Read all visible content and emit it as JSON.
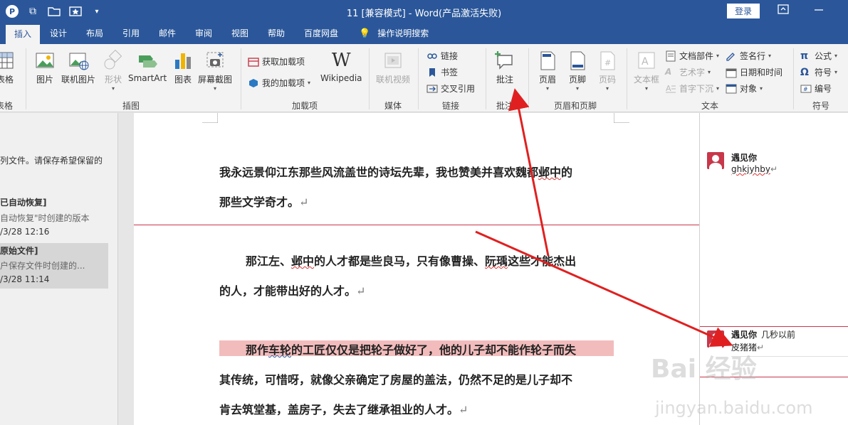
{
  "titlebar": {
    "title": "11 [兼容模式]  -  Word(产品激活失败)",
    "login": "登录",
    "qat_icons": [
      "powerpoint-icon",
      "window-switch-icon",
      "open-folder-icon",
      "favorite-icon",
      "customize-qat-icon"
    ]
  },
  "tabs": {
    "items": [
      "插入",
      "设计",
      "布局",
      "引用",
      "邮件",
      "审阅",
      "视图",
      "帮助",
      "百度网盘"
    ],
    "active": "插入",
    "tell_me": "操作说明搜索"
  },
  "ribbon": {
    "table_group": {
      "btn": "表格",
      "label": "表格"
    },
    "illustrations": {
      "label": "插图",
      "picture": "图片",
      "online_picture": "联机图片",
      "shapes": "形状",
      "smartart": "SmartArt",
      "chart": "图表",
      "screenshot": "屏幕截图"
    },
    "addins": {
      "label": "加载项",
      "get_addins": "获取加载项",
      "my_addins": "我的加载项",
      "wikipedia": "Wikipedia"
    },
    "media": {
      "label": "媒体",
      "online_video": "联机视频"
    },
    "links": {
      "label": "链接",
      "link": "链接",
      "bookmark": "书签",
      "cross_ref": "交叉引用"
    },
    "comments": {
      "label": "批注",
      "comment": "批注"
    },
    "header_footer": {
      "label": "页眉和页脚",
      "header": "页眉",
      "footer": "页脚",
      "page_number": "页码"
    },
    "text": {
      "label": "文本",
      "textbox": "文本框",
      "quick_parts": "文档部件",
      "wordart": "艺术字",
      "drop_cap": "首字下沉",
      "signature": "签名行",
      "datetime": "日期和时间",
      "object": "对象"
    },
    "symbols": {
      "label": "符号",
      "equation": "公式",
      "symbol": "符号",
      "numbering": "编号"
    }
  },
  "left_pane": {
    "intro": "列文件。请保存希望保留的",
    "items": [
      {
        "title": "已自动恢复]",
        "desc": "自动恢复\"时创建的版本",
        "time": "/3/28 12:16"
      },
      {
        "title": "原始文件]",
        "desc": "户保存文件时创建的...",
        "time": "/3/28 11:14"
      }
    ]
  },
  "document": {
    "paragraphs": [
      {
        "line1_pre": "我永远景仰江东那些风流盖世的诗坛先辈，我也赞美并喜欢魏都",
        "line1_wavy": "邺中",
        "line1_post": "的",
        "line2": "那些文学奇才。"
      },
      {
        "line1_pre": "那江左、",
        "line1_wavy": "邺中",
        "line1_mid": "的人才都是些良马，只有像曹操、",
        "line1_wavy2": "阮瑀",
        "line1_post": "这些才能杰出",
        "line2": "的人，才能带出好的人才。"
      },
      {
        "line1_pre": "那作",
        "line1_wavy": "车轮",
        "line1_post": "的工匠仅仅是把轮子做好了，他的儿子却不能作轮子而失",
        "line2": "其传统，可惜呀，就像父亲确定了房屋的盖法，仍然不足的是儿子却不",
        "line3": "肯去筑堂基，盖房子，失去了继承祖业的人才。"
      }
    ],
    "paragraph_mark": "↵"
  },
  "comments": [
    {
      "author": "遇见你",
      "time": "",
      "text": "ghkjyhby"
    },
    {
      "author": "遇见你",
      "time": "几秒以前",
      "text": "皮猪猪"
    }
  ],
  "watermark": {
    "main": "Bai 经验",
    "sub": "jingyan.baidu.com"
  },
  "colors": {
    "word_blue": "#2b579a",
    "comment_red": "#c8374a",
    "arrow_red": "#e02020",
    "highlight": "#f2bcbc"
  }
}
